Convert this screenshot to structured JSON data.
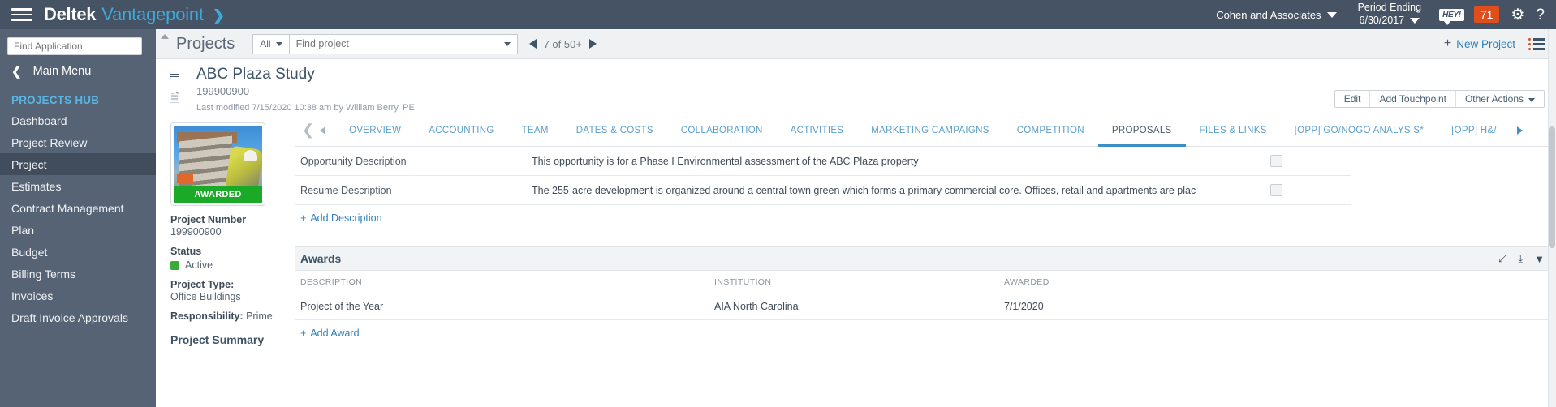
{
  "topbar": {
    "menu_icon": "hamburger-icon",
    "brand_primary": "Deltek",
    "brand_secondary": "Vantagepoint",
    "brand_chevron": "❯",
    "company": "Cohen and Associates",
    "period_label": "Period Ending",
    "period_value": "6/30/2017",
    "hey_badge": "HEY!",
    "notification_count": "71",
    "gear_icon": "⚙",
    "help_icon": "?",
    "bg_color": "#455364",
    "accent_color": "#3fa9d8",
    "badge_color": "#e04e1b"
  },
  "sidebar": {
    "search_placeholder": "Find Application",
    "search_value": "",
    "back_label": "Main Menu",
    "hub_title": "PROJECTS HUB",
    "items": [
      {
        "label": "Dashboard",
        "active": false
      },
      {
        "label": "Project Review",
        "active": false
      },
      {
        "label": "Project",
        "active": true
      },
      {
        "label": "Estimates",
        "active": false
      },
      {
        "label": "Contract Management",
        "active": false
      },
      {
        "label": "Plan",
        "active": false
      },
      {
        "label": "Budget",
        "active": false
      },
      {
        "label": "Billing Terms",
        "active": false
      },
      {
        "label": "Invoices",
        "active": false
      },
      {
        "label": "Draft Invoice Approvals",
        "active": false
      }
    ]
  },
  "toolbar": {
    "title": "Projects",
    "filter_label": "All",
    "search_placeholder": "Find project",
    "search_value": "",
    "pager_text": "7 of 50+",
    "new_project_label": "New Project",
    "plus_glyph": "+",
    "list_icon": "list-view-icon"
  },
  "project_header": {
    "name": "ABC Plaza Study",
    "number": "199900900",
    "modified": "Last modified 7/15/2020 10:38 am by William Berry, PE",
    "actions": [
      "Edit",
      "Add Touchpoint",
      "Other Actions"
    ]
  },
  "info_panel": {
    "thumbnail_badge": "AWARDED",
    "project_number_label": "Project Number",
    "project_number_value": "199900900",
    "status_label": "Status",
    "status_value": "Active",
    "status_color": "#3aab38",
    "project_type_label": "Project Type:",
    "project_type_value": "Office Buildings",
    "responsibility_label": "Responsibility:",
    "responsibility_value": "Prime",
    "summary_link": "Project Summary"
  },
  "tabs": [
    {
      "label": "OVERVIEW",
      "active": false
    },
    {
      "label": "ACCOUNTING",
      "active": false
    },
    {
      "label": "TEAM",
      "active": false
    },
    {
      "label": "DATES & COSTS",
      "active": false
    },
    {
      "label": "COLLABORATION",
      "active": false
    },
    {
      "label": "ACTIVITIES",
      "active": false
    },
    {
      "label": "MARKETING CAMPAIGNS",
      "active": false
    },
    {
      "label": "COMPETITION",
      "active": false
    },
    {
      "label": "PROPOSALS",
      "active": true
    },
    {
      "label": "FILES & LINKS",
      "active": false
    },
    {
      "label": "[OPP] GO/NOGO ANALYSIS*",
      "active": false
    },
    {
      "label": "[OPP] H&/",
      "active": false
    }
  ],
  "descriptions": {
    "rows": [
      {
        "label": "Opportunity Description",
        "value": "This opportunity is for a Phase I Environmental assessment of the ABC Plaza property"
      },
      {
        "label": "Resume Description",
        "value": "The 255-acre development is organized around a central town green which forms a primary commercial core. Offices, retail and apartments are plac"
      }
    ],
    "add_label": "Add Description"
  },
  "awards": {
    "section_title": "Awards",
    "icons": [
      "expand-icon",
      "download-icon",
      "filter-icon"
    ],
    "columns": [
      "DESCRIPTION",
      "INSTITUTION",
      "AWARDED"
    ],
    "rows": [
      {
        "description": "Project of the Year",
        "institution": "AIA North Carolina",
        "awarded": "7/1/2020"
      }
    ],
    "add_label": "Add Award"
  }
}
